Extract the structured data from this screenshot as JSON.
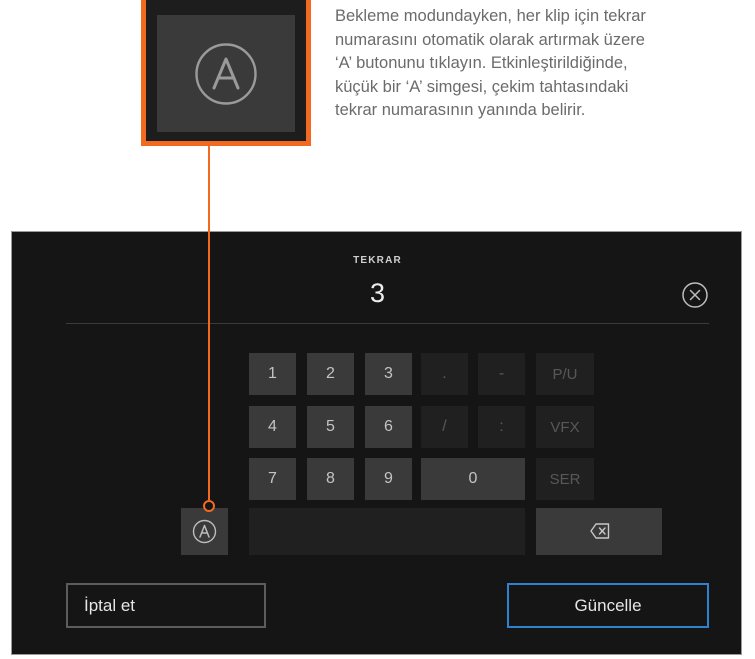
{
  "callout": {
    "icon": "a-circle-icon",
    "description_lines": [
      "Bekleme modundayken, her klip için tekrar",
      "numarasını otomatik olarak artırmak üzere",
      "‘A’ butonunu tıklayın. Etkinleştirildiğinde,",
      "küçük bir ‘A’ simgesi, çekim tahtasındaki",
      "tekrar numarasının yanında belirir."
    ]
  },
  "field": {
    "label": "TEKRAR",
    "value": "3"
  },
  "keypad": {
    "keys": [
      "1",
      "2",
      "3",
      ".",
      "-",
      "P/U",
      "4",
      "5",
      "6",
      "/",
      ":",
      "VFX",
      "7",
      "8",
      "9",
      "0",
      "SER"
    ],
    "auto_increment_icon": "a-circle-icon",
    "backspace_icon": "backspace-icon"
  },
  "buttons": {
    "cancel": "İptal et",
    "update": "Güncelle"
  },
  "colors": {
    "accent_orange": "#f26a21",
    "accent_blue": "#2f83ce",
    "panel_bg": "#151515"
  }
}
